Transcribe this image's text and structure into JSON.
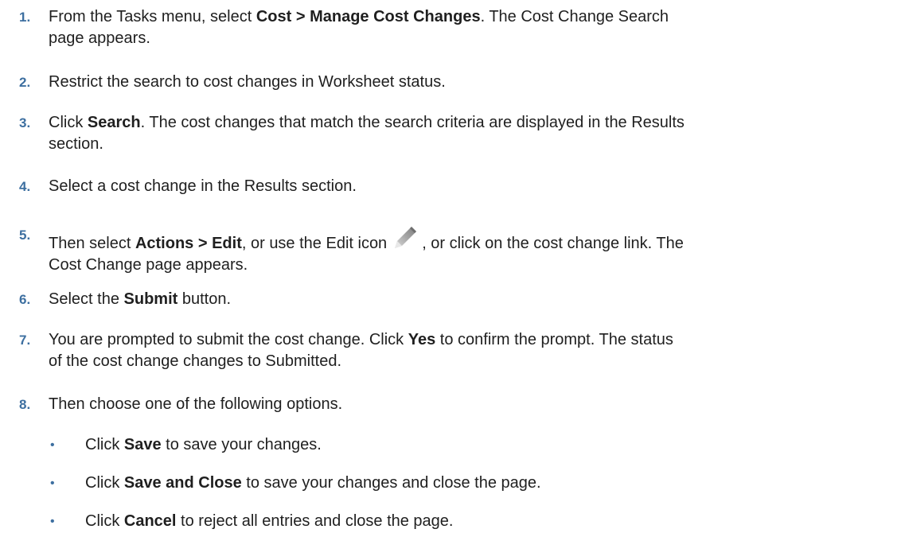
{
  "steps": [
    {
      "number": "1.",
      "parts": [
        "From the Tasks menu, select ",
        "Cost > Manage Cost Changes",
        ". The Cost Change Search",
        "page appears."
      ]
    },
    {
      "number": "2.",
      "parts": [
        "Restrict the search to cost changes in Worksheet status."
      ]
    },
    {
      "number": "3.",
      "parts": [
        "Click ",
        "Search",
        ". The cost changes that match the search criteria are displayed in the Results",
        "section."
      ]
    },
    {
      "number": "4.",
      "parts": [
        "Select a cost change in the Results section."
      ]
    },
    {
      "number": "5.",
      "parts": [
        "Then select ",
        "Actions > Edit",
        ", or use the Edit icon",
        ", or click on the cost change link. The",
        "Cost Change page appears."
      ]
    },
    {
      "number": "6.",
      "parts": [
        "Select the ",
        "Submit",
        " button."
      ]
    },
    {
      "number": "7.",
      "parts": [
        "You are prompted to submit the cost change. Click ",
        "Yes",
        " to confirm the prompt. The status",
        "of the cost change changes to Submitted."
      ]
    },
    {
      "number": "8.",
      "parts": [
        "Then choose one of the following options."
      ]
    }
  ],
  "options": [
    {
      "bullet": "•",
      "pre": "Click ",
      "bold": "Save",
      "post": " to save your changes."
    },
    {
      "bullet": "•",
      "pre": "Click ",
      "bold": "Save and Close",
      "post": " to save your changes and close the page."
    },
    {
      "bullet": "•",
      "pre": "Click ",
      "bold": "Cancel",
      "post": " to reject all entries and close the page."
    }
  ],
  "icons": {
    "edit": "pencil-icon"
  },
  "colors": {
    "number": "#3d6fa0",
    "text": "#1f1f1f"
  }
}
